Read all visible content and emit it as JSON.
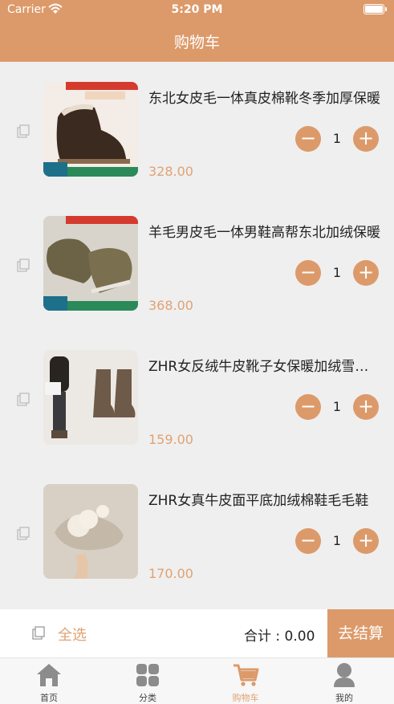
{
  "status_bar": {
    "carrier": "Carrier",
    "time": "5:20 PM"
  },
  "header": {
    "title": "购物车"
  },
  "cart": {
    "items": [
      {
        "name": "东北女皮毛一体真皮棉靴冬季加厚保暖",
        "quantity": "1",
        "price": "328.00",
        "minus": "−",
        "plus": "+"
      },
      {
        "name": "羊毛男皮毛一体男鞋高帮东北加绒保暖",
        "quantity": "1",
        "price": "368.00",
        "minus": "−",
        "plus": "+"
      },
      {
        "name": "ZHR女反绒牛皮靴子女保暖加绒雪地靴",
        "quantity": "1",
        "price": "159.00",
        "minus": "−",
        "plus": "+"
      },
      {
        "name": "ZHR女真牛皮面平底加绒棉鞋毛毛鞋",
        "quantity": "1",
        "price": "170.00",
        "minus": "−",
        "plus": "+"
      }
    ]
  },
  "footer": {
    "select_all": "全选",
    "total_label": "合计",
    "total_value": "0.00",
    "checkout": "去结算"
  },
  "tabbar": {
    "tabs": [
      {
        "label": "首页"
      },
      {
        "label": "分类"
      },
      {
        "label": "购物车"
      },
      {
        "label": "我的"
      }
    ]
  },
  "colors": {
    "accent": "#dc9a6a",
    "price": "#e0a273",
    "background": "#efefef"
  }
}
